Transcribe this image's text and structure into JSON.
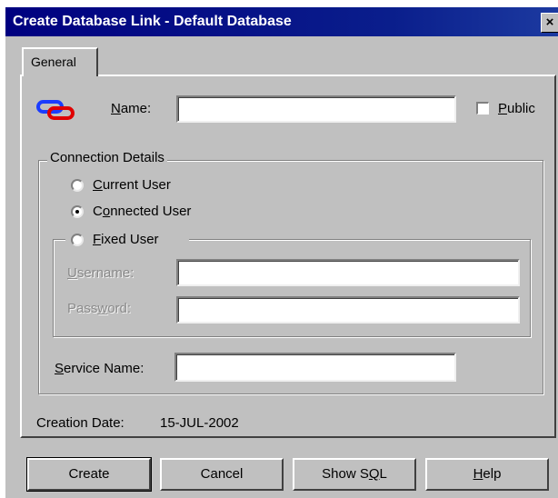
{
  "window": {
    "title": "Create Database Link - Default Database",
    "close_glyph": "×"
  },
  "tabs": [
    {
      "label": "General",
      "active": true
    }
  ],
  "general": {
    "link_icon": "database-link-icon",
    "name_label": "Name:",
    "name_value": "",
    "public_label": "Public",
    "public_checked": false,
    "connection_details": {
      "legend": "Connection Details",
      "options": [
        {
          "label": "Current User",
          "checked": false
        },
        {
          "label": "Connected User",
          "checked": true
        },
        {
          "label": "Fixed User",
          "checked": false
        }
      ],
      "username_label": "Username:",
      "username_value": "",
      "password_label": "Password:",
      "password_value": ""
    },
    "service_name_label": "Service Name:",
    "service_name_value": "",
    "creation_date_label": "Creation Date:",
    "creation_date_value": "15-JUL-2002"
  },
  "buttons": {
    "create": "Create",
    "cancel": "Cancel",
    "show_sql": "Show SQL",
    "help": "Help"
  },
  "colors": {
    "titlebar": "#000080",
    "face": "#c0c0c0",
    "icon_blue": "#1a3cff",
    "icon_red": "#e00000"
  }
}
